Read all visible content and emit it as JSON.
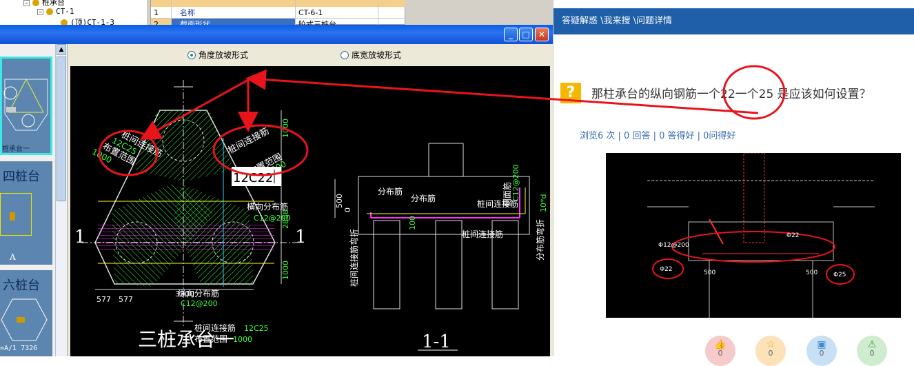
{
  "tree": {
    "root_label": "桩承台",
    "node_label": "CT-1",
    "child_label": "(顶)CT-1-3"
  },
  "grid": {
    "headers": [
      "",
      "",
      "",
      ""
    ],
    "row1": {
      "num": "1",
      "name_label": "名称",
      "value": "CT-6-1"
    },
    "row2": {
      "num": "2",
      "name_label": "截面形状",
      "value": "阶式三桩台"
    }
  },
  "dialog": {
    "radio_angle": "角度放坡形式",
    "radio_width": "底宽放坡形式",
    "title_buttons": {
      "min": "_",
      "max": "□",
      "close": "✕"
    }
  },
  "thumbnails": [
    {
      "label": "桩承台一"
    },
    {
      "label": "四桩台",
      "sub": "A"
    },
    {
      "label": "六桩台",
      "sub": "=A/1 7326"
    }
  ],
  "cad": {
    "title_main": "三桩承台一",
    "title_section": "1-1",
    "input_value": "12C22",
    "section_mark": "1",
    "labels": {
      "left_conn": "桩间连接筋",
      "left_conn_spec": "12C25",
      "left_range": "布置范围",
      "left_range_val": "1000",
      "right_conn": "桩间连接筋",
      "right_range": "布置范围",
      "right_range_val": "1000",
      "horiz_dist": "横向分布筋",
      "horiz_dist_spec": "C12@200",
      "long_dist": "纵向分布筋",
      "long_dist_spec": "C12@200",
      "bottom_conn": "桩间连接筋",
      "bottom_conn_spec": "12C25",
      "bottom_range": "布置范围",
      "bottom_range_val": "1000",
      "dim_1000_top": "1000",
      "dim_2858": "2858",
      "dim_1000_bottom": "1000",
      "dim_577a": "577",
      "dim_577b": "577",
      "dim_3300": "3300",
      "sec_dist1": "分布筋",
      "sec_dist2": "分布筋",
      "sec_conn": "桩间连接筋",
      "sec_conn2": "桩间连接筋",
      "sec_side": "侧面筋",
      "sec_side_spec": "C12@200",
      "sec_bend_left": "桩间连接筋弯折",
      "sec_bend_right": "分布筋弯折",
      "sec_500": "500",
      "sec_100": "100",
      "sec_0": "0",
      "sec_10d": "10*d"
    }
  },
  "right": {
    "breadcrumb": "答疑解惑 \\我来搜 \\问题详情",
    "question_icon": "?",
    "question": "那柱承台的纵向钢筋一个22一个25  是应该如何设置？",
    "stats": "浏览6 次 | 0 回答 | 0 答得好 | 0问得好",
    "image_labels": {
      "left_mark": "Φ22",
      "right_mark": "Φ25",
      "mid_mark": "Φ22",
      "left_dim": "500",
      "right_dim": "500",
      "dist": "Φ12@200"
    },
    "actions": [
      {
        "icon": "thumbs-up",
        "glyph": "👍",
        "count": "0",
        "color": "#f6c9cb"
      },
      {
        "icon": "star",
        "glyph": "☆",
        "count": "0",
        "color": "#fbe2b8"
      },
      {
        "icon": "save",
        "glyph": "▣",
        "count": "0",
        "color": "#c8e0f5"
      },
      {
        "icon": "warning",
        "glyph": "⚠",
        "count": "0",
        "color": "#cfeccf"
      }
    ]
  },
  "colors": {
    "breadcrumb_bg": "#1f5ea8",
    "annotation_red": "#e8141c",
    "cad_green": "#3cff3c",
    "cad_magenta": "#ff30ff",
    "cad_yellow": "#ffff30"
  }
}
